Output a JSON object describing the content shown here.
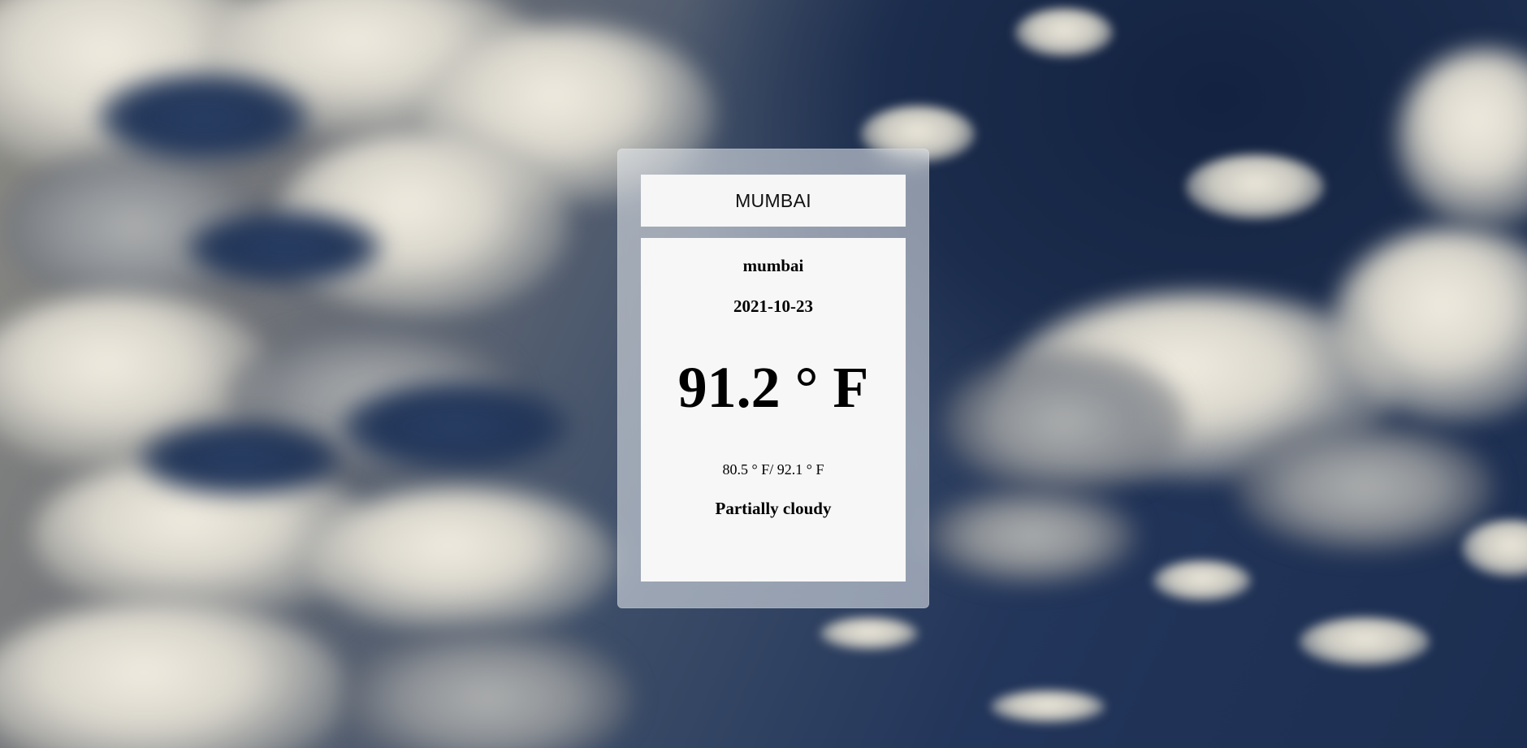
{
  "background": {
    "description_icon": "cloudy-sky-image",
    "colors": {
      "sky_dark": "#1c2e50",
      "cloud_light": "#ece7da"
    }
  },
  "card": {
    "header_city": "MUMBAI",
    "location": "mumbai",
    "date": "2021-10-23",
    "temperature": "91.2 ° F",
    "temp_range": "80.5 ° F/ 92.1 ° F",
    "condition": "Partially cloudy"
  }
}
